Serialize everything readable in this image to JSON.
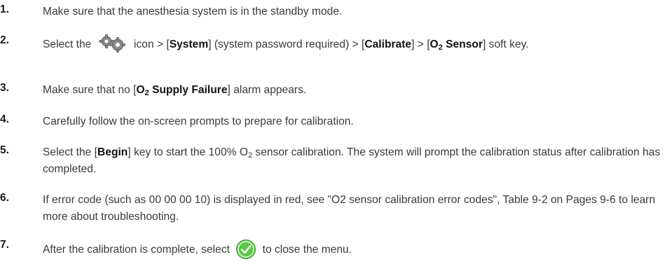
{
  "steps": [
    {
      "num": "1.",
      "text": "Make sure that the anesthesia system is in the standby mode."
    },
    {
      "num": "2.",
      "pre": "Select the ",
      "icon": "gear-icon",
      "post1": " icon > [",
      "system": "System",
      "post2": "] (system password required) > [",
      "calibrate": "Calibrate",
      "post3": "] > [",
      "o2": "O",
      "o2_sub": "2",
      "sensor": " Sensor",
      "post4": "] soft key."
    },
    {
      "num": "3.",
      "pre": "Make sure that no [",
      "o2": "O",
      "o2_sub": "2",
      "bold_rest": " Supply Failure",
      "post": "] alarm appears."
    },
    {
      "num": "4.",
      "text": "Carefully follow the on-screen prompts to prepare for calibration."
    },
    {
      "num": "5.",
      "pre": "Select the [",
      "begin": "Begin",
      "mid": "] key to start the 100% O",
      "sub": "2",
      "post": " sensor calibration. The system will prompt the calibration status after calibration has completed."
    },
    {
      "num": "6.",
      "text": "If error code (such as 00 00 00 10) is displayed in red, see \"O2 sensor calibration error codes\", Table 9-2 on Pages 9-6 to learn more about troubleshooting."
    },
    {
      "num": "7.",
      "pre": "After the calibration is complete, select ",
      "icon": "check-icon",
      "post": " to close the menu."
    }
  ],
  "colors": {
    "text": "#3a3a3a",
    "check_green": "#5cc84a",
    "gear_gray": "#8a8a8a"
  }
}
